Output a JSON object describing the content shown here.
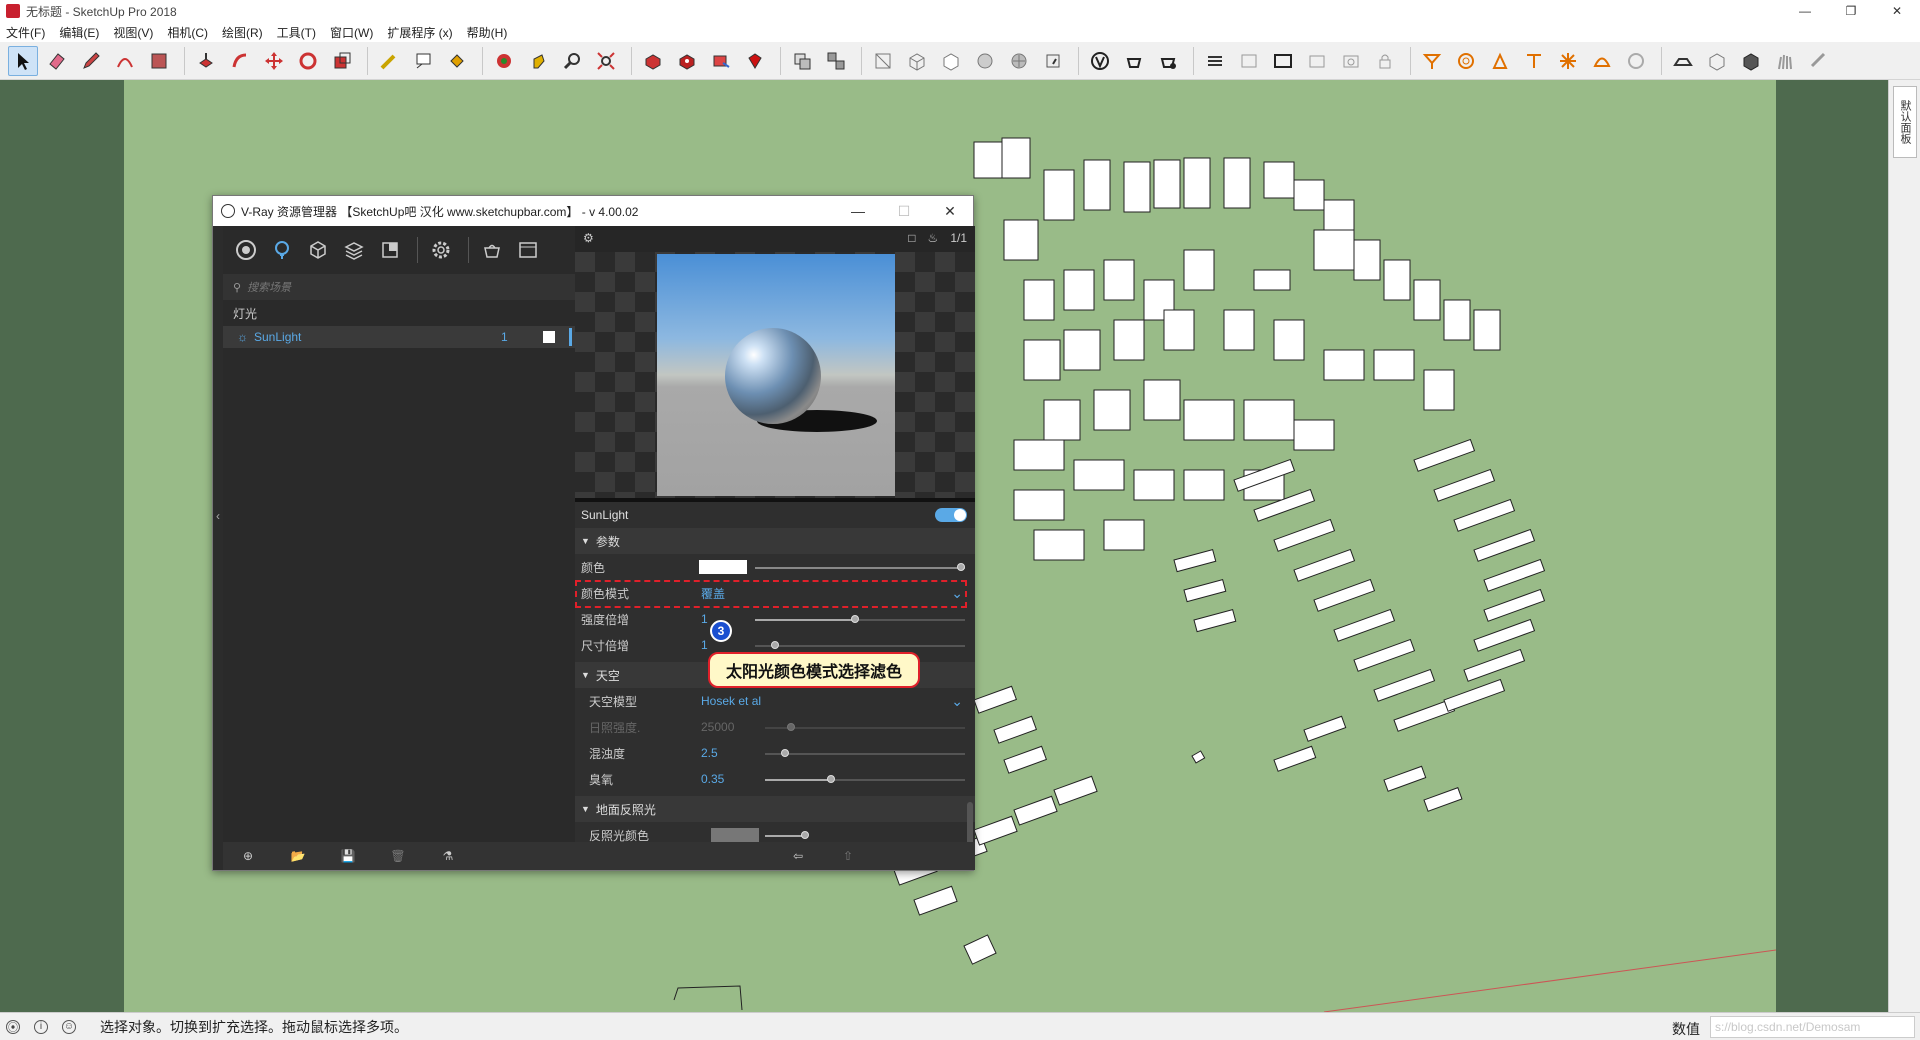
{
  "window": {
    "title": "无标题 - SketchUp Pro 2018"
  },
  "menu": [
    "文件(F)",
    "编辑(E)",
    "视图(V)",
    "相机(C)",
    "绘图(R)",
    "工具(T)",
    "窗口(W)",
    "扩展程序 (x)",
    "帮助(H)"
  ],
  "toolbar": {
    "icons": [
      "select-icon",
      "eraser-icon",
      "pencil-icon",
      "arc-icon",
      "rectangle-icon",
      "push-pull-icon",
      "follow-me-icon",
      "move-icon",
      "rotate-icon",
      "scale-icon",
      "tape-measure-icon",
      "text-icon",
      "paint-bucket-icon",
      "orbit-icon",
      "pan-icon",
      "zoom-icon",
      "zoom-extents-icon",
      "warehouse-icon",
      "extension-warehouse-icon",
      "layout-icon",
      "ruby-icon",
      "components-icon",
      "groups-icon",
      "xray-icon",
      "wireframe-icon",
      "hidden-line-icon",
      "shaded-icon",
      "textured-icon",
      "monochrome-icon",
      "vray-logo-icon",
      "teapot-icon",
      "interactive-render-icon",
      "section-plane-icon",
      "section-display-icon",
      "camera-icon",
      "frame-buffer-icon",
      "lock-icon",
      "light-icon",
      "sphere-light-icon",
      "spot-light-icon",
      "ies-light-icon",
      "omni-light-icon",
      "dome-light-icon",
      "mesh-light-icon",
      "proxy-icon",
      "plane-icon",
      "cube-icon",
      "fur-icon",
      "scatter-icon"
    ]
  },
  "vray": {
    "title": "V-Ray 资源管理器 【SketchUp吧 汉化 www.sketchupbar.com】 - v 4.00.02",
    "search_placeholder": "搜索场景",
    "category": "灯光",
    "light_item": "SunLight",
    "light_count": "1",
    "preview_ratio": "1/1",
    "panel_title": "SunLight",
    "sections": {
      "params": "参数",
      "sky": "天空",
      "ground": "地面反照光"
    },
    "fields": {
      "color": "颜色",
      "color_mode": "颜色模式",
      "color_mode_value": "覆盖",
      "intensity": "强度倍增",
      "intensity_value": "1",
      "size": "尺寸倍增",
      "size_value": "1",
      "sky_model": "天空模型",
      "sky_model_value": "Hosek et al",
      "sun_intensity": "日照强度.",
      "sun_intensity_value": "25000",
      "turbidity": "混浊度",
      "turbidity_value": "2.5",
      "ozone": "臭氧",
      "ozone_value": "0.35",
      "albedo": "反照光颜色"
    }
  },
  "annotation": {
    "step": "3",
    "callout": "太阳光颜色模式选择滤色"
  },
  "tray": {
    "tab": "默认面板"
  },
  "status": {
    "text": "选择对象。切换到扩充选择。拖动鼠标选择多项。",
    "measure_label": "数值",
    "measure_value": "s://blog.csdn.net/Demosam"
  },
  "colors": {
    "accent": "#5aa9e6",
    "highlight": "#e0202a",
    "ground": "#99bb88"
  }
}
